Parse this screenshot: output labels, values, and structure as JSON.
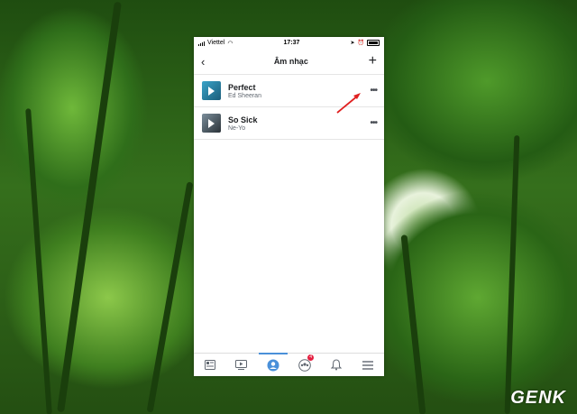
{
  "status_bar": {
    "carrier": "Viettel",
    "time": "17:37"
  },
  "header": {
    "title": "Âm nhạc",
    "back_icon": "back-chevron-icon",
    "add_icon": "plus-icon"
  },
  "songs": [
    {
      "title": "Perfect",
      "artist": "Ed Sheeran"
    },
    {
      "title": "So Sick",
      "artist": "Ne-Yo"
    }
  ],
  "more_label": "•••",
  "tab_bar": {
    "tabs": [
      "news-feed-icon",
      "video-icon",
      "profile-icon",
      "groups-icon",
      "notifications-icon",
      "menu-icon"
    ],
    "active_tab": "profile-icon",
    "groups_badge": "4"
  },
  "watermark": "GENK",
  "colors": {
    "accent": "#4a90d9",
    "badge": "#e41e3f",
    "arrow": "#e02020"
  }
}
